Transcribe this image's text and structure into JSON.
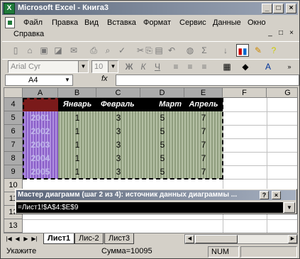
{
  "window": {
    "title": "Microsoft Excel - Книга3",
    "minimize": "_",
    "maximize": "□",
    "close": "×"
  },
  "menu": {
    "items": [
      "Файл",
      "Правка",
      "Вид",
      "Вставка",
      "Формат",
      "Сервис",
      "Данные",
      "Окно"
    ],
    "second_row": "Справка",
    "doc_controls": [
      "_",
      "□",
      "×"
    ]
  },
  "toolbar": {
    "standard_icons": [
      "new-icon",
      "open-icon",
      "save-icon",
      "permission-icon",
      "email-icon",
      "print-icon",
      "print-preview-icon",
      "spelling-icon",
      "cut-icon",
      "copy-icon",
      "paste-icon",
      "undo-icon",
      "hyperlink-icon",
      "autosum-icon",
      "sort-icon",
      "chart-wizard-icon",
      "drawing-icon",
      "help-icon"
    ],
    "autosum": "Σ",
    "font_name": "Arial Cyr",
    "font_size": "10",
    "bold": "Ж",
    "italic": "К",
    "underline": "Ч"
  },
  "formula_bar": {
    "name_box": "A4",
    "fx": "fx",
    "value": ""
  },
  "sheet": {
    "columns": [
      "A",
      "B",
      "C",
      "D",
      "E",
      "F",
      "G"
    ],
    "rows": [
      "4",
      "5",
      "6",
      "7",
      "8",
      "9",
      "10",
      "11",
      "12",
      "13"
    ],
    "header_row": [
      "",
      "Январь",
      "Февраль",
      "",
      "Март",
      "Апрель"
    ],
    "data": [
      [
        "2001",
        "1",
        "3",
        "5",
        "7"
      ],
      [
        "2002",
        "1",
        "3",
        "5",
        "7"
      ],
      [
        "2003",
        "1",
        "3",
        "5",
        "7"
      ],
      [
        "2004",
        "1",
        "3",
        "5",
        "7"
      ],
      [
        "2005",
        "1",
        "3",
        "5",
        "7"
      ]
    ]
  },
  "dialog": {
    "title": "Мастер диаграмм (шаг 2 из 4): источник данных диаграммы ...",
    "help": "?",
    "close": "×",
    "range": "=Лист1!$A$4:$E$9",
    "collapse": "▼"
  },
  "tabs": {
    "items": [
      "Лист1",
      "Лис-2",
      "Лист3"
    ],
    "active": "Лист1"
  },
  "status": {
    "mode": "Укажите",
    "sum": "Сумма=10095",
    "num": "NUM"
  },
  "colors": {
    "title_gradient_start": "#5f6b7e",
    "year_column": "#9b6fd0",
    "data_cells": "#a0ad8e",
    "header_cells": "#000000"
  }
}
